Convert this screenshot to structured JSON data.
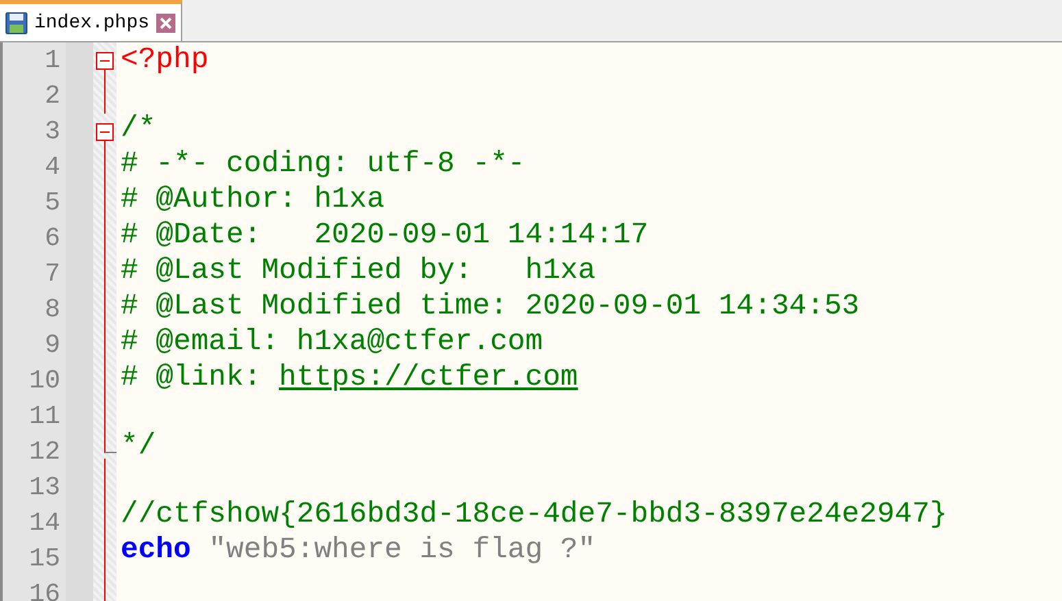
{
  "tabs": [
    {
      "label": "index.phps",
      "selected": true
    }
  ],
  "editor": {
    "lines": [
      {
        "number": "1",
        "kind": "fold-start",
        "tokens": [
          {
            "kind": "tag",
            "text": "<?php"
          }
        ]
      },
      {
        "number": "2",
        "kind": "fold-body"
      },
      {
        "number": "3",
        "kind": "fold-start",
        "tokens": [
          {
            "kind": "comment",
            "text": "/*"
          }
        ]
      },
      {
        "number": "4",
        "kind": "fold-body",
        "tokens": [
          {
            "kind": "comment",
            "text": "# -*- coding: utf-8 -*-"
          }
        ]
      },
      {
        "number": "5",
        "kind": "fold-body",
        "tokens": [
          {
            "kind": "comment",
            "text": "# @Author: h1xa"
          }
        ]
      },
      {
        "number": "6",
        "kind": "fold-body",
        "tokens": [
          {
            "kind": "comment",
            "text": "# @Date:   2020-09-01 14:14:17"
          }
        ]
      },
      {
        "number": "7",
        "kind": "fold-body",
        "tokens": [
          {
            "kind": "comment",
            "text": "# @Last Modified by:   h1xa"
          }
        ]
      },
      {
        "number": "8",
        "kind": "fold-body",
        "tokens": [
          {
            "kind": "comment",
            "text": "# @Last Modified time: 2020-09-01 14:34:53"
          }
        ]
      },
      {
        "number": "9",
        "kind": "fold-body",
        "tokens": [
          {
            "kind": "comment",
            "text": "# @email: h1xa@ctfer.com"
          }
        ]
      },
      {
        "number": "10",
        "kind": "fold-body",
        "tokens": [
          {
            "kind": "comment",
            "text": "# @link: "
          },
          {
            "kind": "link",
            "text": "https://ctfer.com"
          }
        ]
      },
      {
        "number": "11",
        "kind": "fold-body"
      },
      {
        "number": "12",
        "kind": "fold-end",
        "tokens": [
          {
            "kind": "comment",
            "text": "*/"
          }
        ]
      },
      {
        "number": "13",
        "kind": "fold-body"
      },
      {
        "number": "14",
        "kind": "fold-body",
        "tokens": [
          {
            "kind": "comment",
            "text": "//ctfshow{2616bd3d-18ce-4de7-bbd3-8397e24e2947}"
          }
        ]
      },
      {
        "number": "15",
        "kind": "fold-body",
        "tokens": [
          {
            "kind": "keyword",
            "text": "echo "
          },
          {
            "kind": "string",
            "text": "\"web5:where is flag ?\""
          }
        ]
      },
      {
        "number": "16",
        "kind": "fold-body"
      }
    ]
  }
}
